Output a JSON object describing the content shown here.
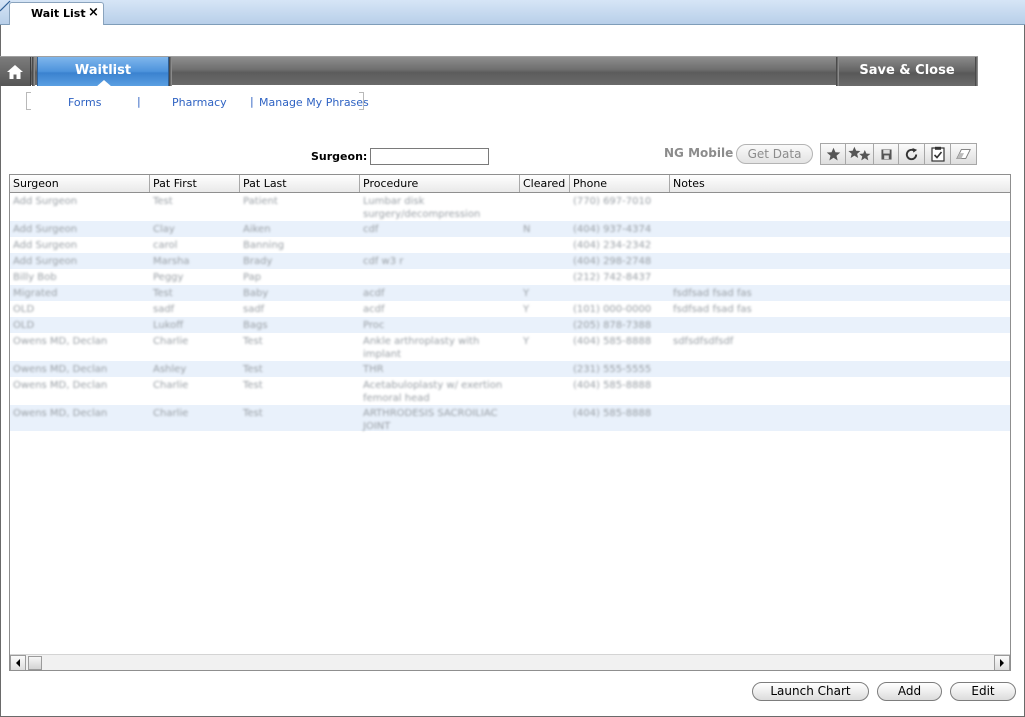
{
  "window": {
    "tab_label": "Wait List",
    "close_glyph": "×"
  },
  "nav": {
    "home_icon": "home-icon",
    "active_tab": "Waitlist",
    "save_close": "Save & Close"
  },
  "sublinks": {
    "forms": "Forms",
    "pharmacy": "Pharmacy",
    "manage_phrases": "Manage My Phrases",
    "separator": "|"
  },
  "filter": {
    "surgeon_label": "Surgeon:",
    "surgeon_value": ""
  },
  "mobile": {
    "label": "NG Mobile",
    "get_data": "Get Data"
  },
  "toolbar_icons": [
    "star-icon",
    "multi-star-icon",
    "save-icon",
    "refresh-icon",
    "clipboard-check-icon",
    "eraser-icon"
  ],
  "grid": {
    "columns": [
      "Surgeon",
      "Pat First",
      "Pat Last",
      "Procedure",
      "Cleared",
      "Phone",
      "Notes"
    ],
    "rows": [
      [
        "Add Surgeon",
        "Test",
        "Patient",
        "Lumbar disk surgery/decompression",
        "",
        "(770) 697-7010",
        ""
      ],
      [
        "Add Surgeon",
        "Clay",
        "Aiken",
        "cdf",
        "N",
        "(404) 937-4374",
        ""
      ],
      [
        "Add Surgeon",
        "carol",
        "Banning",
        "",
        "",
        "(404) 234-2342",
        ""
      ],
      [
        "Add Surgeon",
        "Marsha",
        "Brady",
        "cdf w3 r",
        "",
        "(404) 298-2748",
        ""
      ],
      [
        "Billy Bob",
        "Peggy",
        "Pap",
        "",
        "",
        "(212) 742-8437",
        ""
      ],
      [
        "Migrated",
        "Test",
        "Baby",
        "acdf",
        "Y",
        "",
        "fsdfsad fsad fas"
      ],
      [
        "OLD",
        "sadf",
        "sadf",
        "acdf",
        "Y",
        "(101) 000-0000",
        "fsdfsad fsad fas"
      ],
      [
        "OLD",
        "Lukoff",
        "Bags",
        "Proc",
        "",
        "(205) 878-7388",
        ""
      ],
      [
        "Owens MD, Declan",
        "Charlie",
        "Test",
        "Ankle arthroplasty with implant",
        "Y",
        "(404) 585-8888",
        "sdfsdfsdfsdf"
      ],
      [
        "Owens MD, Declan",
        "Ashley",
        "Test",
        "THR",
        "",
        "(231) 555-5555",
        ""
      ],
      [
        "Owens MD, Declan",
        "Charlie",
        "Test",
        "Acetabuloplasty w/ exertion femoral head",
        "",
        "(404) 585-8888",
        ""
      ],
      [
        "Owens MD, Declan",
        "Charlie",
        "Test",
        "ARTHRODESIS SACROILIAC JOINT",
        "",
        "(404) 585-8888",
        ""
      ]
    ]
  },
  "buttons": {
    "launch_chart": "Launch Chart",
    "add": "Add",
    "edit": "Edit"
  }
}
